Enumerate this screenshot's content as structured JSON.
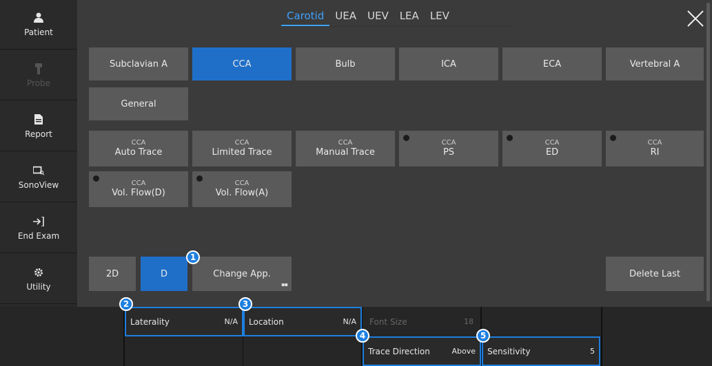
{
  "sidebar": {
    "items": [
      {
        "label": "Patient",
        "icon": "person-icon"
      },
      {
        "label": "Probe",
        "icon": "probe-icon"
      },
      {
        "label": "Report",
        "icon": "document-icon"
      },
      {
        "label": "SonoView",
        "icon": "sonoview-icon"
      },
      {
        "label": "End Exam",
        "icon": "exit-icon"
      },
      {
        "label": "Utility",
        "icon": "gear-icon"
      }
    ]
  },
  "tabs": [
    "Carotid",
    "UEA",
    "UEV",
    "LEA",
    "LEV"
  ],
  "vessels": [
    "Subclavian A",
    "CCA",
    "Bulb",
    "ICA",
    "ECA",
    "Vertebral A",
    "General"
  ],
  "measurements": [
    {
      "top": "CCA",
      "main": "Auto Trace"
    },
    {
      "top": "CCA",
      "main": "Limited Trace"
    },
    {
      "top": "CCA",
      "main": "Manual Trace"
    },
    {
      "top": "CCA",
      "main": "PS"
    },
    {
      "top": "CCA",
      "main": "ED"
    },
    {
      "top": "CCA",
      "main": "RI"
    },
    {
      "top": "CCA",
      "main": "Vol. Flow(D)"
    },
    {
      "top": "CCA",
      "main": "Vol. Flow(A)"
    }
  ],
  "controls": {
    "mode_2d": "2D",
    "mode_d": "D",
    "change_app": "Change App.",
    "delete_last": "Delete Last"
  },
  "settings": {
    "laterality": {
      "label": "Laterality",
      "value": "N/A"
    },
    "location": {
      "label": "Location",
      "value": "N/A"
    },
    "font_size": {
      "label": "Font Size",
      "value": "18"
    },
    "trace_direction": {
      "label": "Trace Direction",
      "value": "Above"
    },
    "sensitivity": {
      "label": "Sensitivity",
      "value": "5"
    }
  },
  "callouts": [
    "1",
    "2",
    "3",
    "4",
    "5"
  ],
  "colors": {
    "accent": "#1f6fc9",
    "active_tab": "#3fa2ff",
    "button": "#5a5a5a",
    "panel": "#3b3b3b"
  }
}
